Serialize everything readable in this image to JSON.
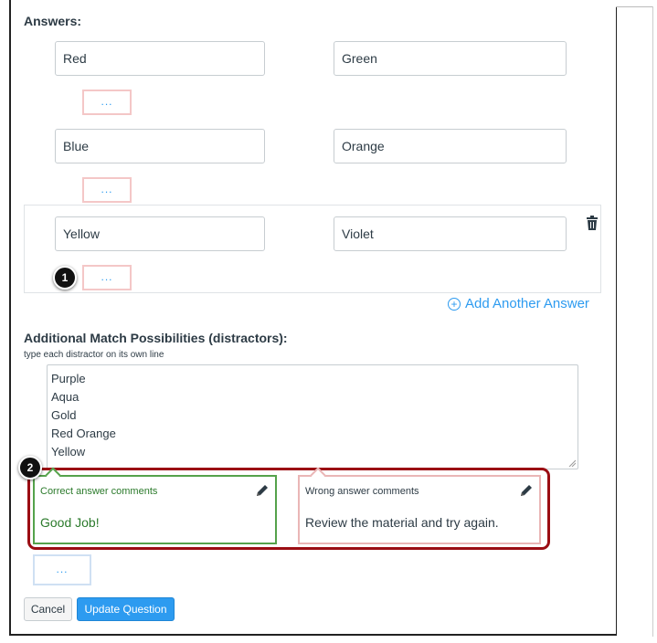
{
  "answers_section": {
    "label": "Answers:",
    "pairs": [
      {
        "left": "Red",
        "right": "Green",
        "comment": "..."
      },
      {
        "left": "Blue",
        "right": "Orange",
        "comment": "..."
      },
      {
        "left": "Yellow",
        "right": "Violet",
        "comment": "..."
      }
    ],
    "add_another": "Add Another Answer"
  },
  "callouts": {
    "one": "1",
    "two": "2"
  },
  "distractors": {
    "title": "Additional Match Possibilities (distractors):",
    "hint": "type each distractor on its own line",
    "lines": [
      "Purple",
      "Aqua",
      "Gold",
      "Red Orange",
      "Yellow"
    ]
  },
  "comments": {
    "correct": {
      "header": "Correct answer comments",
      "body": "Good Job!"
    },
    "wrong": {
      "header": "Wrong answer comments",
      "body": "Review the material and try again."
    },
    "neutral": "..."
  },
  "buttons": {
    "cancel": "Cancel",
    "update": "Update Question"
  },
  "colors": {
    "accent": "#2d9bf0",
    "correct": "#55a24b",
    "wrong": "#eab6b6",
    "highlight": "#9b0d13"
  },
  "icons": {
    "trash": "trash-icon",
    "pencil": "pencil-icon",
    "add": "plus-circle-icon"
  }
}
